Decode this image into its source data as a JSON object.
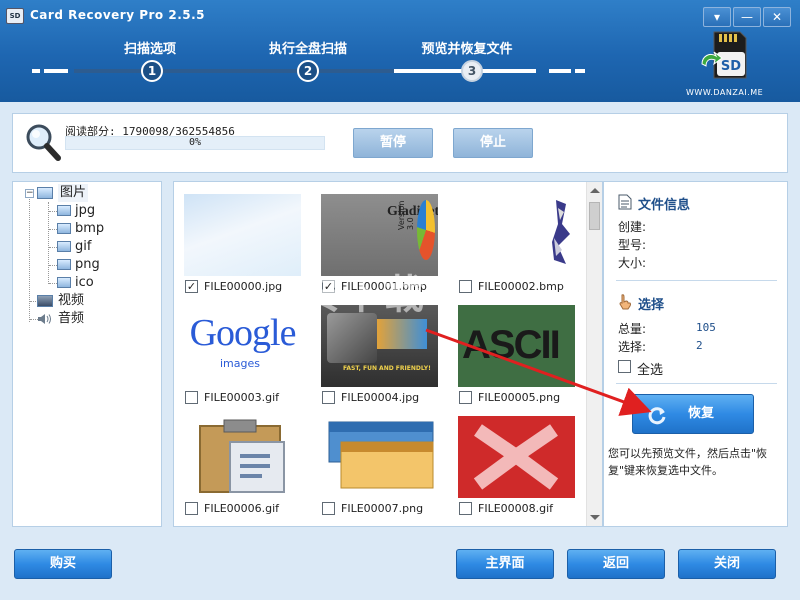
{
  "window": {
    "title": "Card Recovery Pro 2.5.5",
    "controls": [
      "▾",
      "—",
      "✕"
    ],
    "brand_url": "WWW.DANZAI.ME",
    "logo_text": "SD"
  },
  "steps": [
    {
      "number": "1",
      "label": "扫描选项"
    },
    {
      "number": "2",
      "label": "执行全盘扫描"
    },
    {
      "number": "3",
      "label": "预览并恢复文件"
    }
  ],
  "progress": {
    "label": "阅读部分: 1790098/362554856",
    "percent_text": "0%",
    "fraction": 0.0,
    "pause_label": "暂停",
    "stop_label": "停止"
  },
  "tree": {
    "root": "图片",
    "children": [
      "jpg",
      "bmp",
      "gif",
      "png",
      "ico"
    ],
    "video": "视频",
    "audio": "音频"
  },
  "files": [
    {
      "name": "FILE00000.jpg",
      "checked": true
    },
    {
      "name": "FILE00001.bmp",
      "checked": true
    },
    {
      "name": "FILE00002.bmp",
      "checked": false
    },
    {
      "name": "FILE00003.gif",
      "checked": false
    },
    {
      "name": "FILE00004.jpg",
      "checked": false
    },
    {
      "name": "FILE00005.png",
      "checked": false
    },
    {
      "name": "FILE00006.gif",
      "checked": false
    },
    {
      "name": "FILE00007.png",
      "checked": false
    },
    {
      "name": "FILE00008.gif",
      "checked": false
    }
  ],
  "thumb_text": {
    "gladinet": "Gladinet",
    "gladinet_sub": "Version 3.0",
    "google": "Google",
    "google_sub": "images",
    "fast": "FAST, FUN AND FRIENDLY!",
    "ascii": "ASCII"
  },
  "file_info": {
    "title": "文件信息",
    "created_label": "创建:",
    "type_label": "型号:",
    "size_label": "大小:"
  },
  "selection": {
    "title": "选择",
    "total_label": "总量:",
    "total_value": "105",
    "selected_label": "选择:",
    "selected_value": "2",
    "select_all_label": "全选"
  },
  "recover_button": "恢复",
  "hint_text": "您可以先预览文件，然后点击\"恢复\"键来恢复选中文件。",
  "watermark": "安下载",
  "bottom": {
    "buy": "购买",
    "main": "主界面",
    "back": "返回",
    "close": "关闭"
  }
}
